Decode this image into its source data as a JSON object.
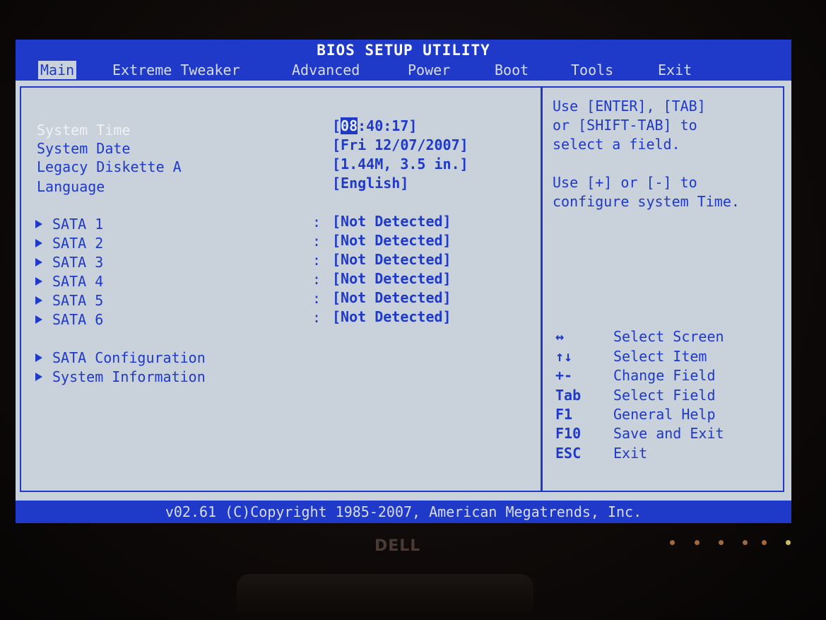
{
  "title": "BIOS SETUP UTILITY",
  "menu": [
    {
      "label": "Main",
      "active": true
    },
    {
      "label": "Extreme Tweaker"
    },
    {
      "label": "Advanced"
    },
    {
      "label": "Power"
    },
    {
      "label": "Boot"
    },
    {
      "label": "Tools"
    },
    {
      "label": "Exit"
    }
  ],
  "settings": [
    {
      "label": "System Time",
      "value_prefix": "[",
      "value_highlight": "08",
      "value_suffix": ":40:17]"
    },
    {
      "label": "System Date",
      "value": "[Fri 12/07/2007]"
    },
    {
      "label": "Legacy Diskette A",
      "value": "[1.44M, 3.5 in.]"
    },
    {
      "label": "Language",
      "value": "[English]"
    }
  ],
  "sata": [
    {
      "label": "SATA 1",
      "sep": ":",
      "value": "[Not Detected]"
    },
    {
      "label": "SATA 2",
      "sep": ":",
      "value": "[Not Detected]"
    },
    {
      "label": "SATA 3",
      "sep": ":",
      "value": "[Not Detected]"
    },
    {
      "label": "SATA 4",
      "sep": ":",
      "value": "[Not Detected]"
    },
    {
      "label": "SATA 5",
      "sep": ":",
      "value": "[Not Detected]"
    },
    {
      "label": "SATA 6",
      "sep": ":",
      "value": "[Not Detected]"
    }
  ],
  "submenus": [
    {
      "label": "SATA Configuration"
    },
    {
      "label": "System Information"
    }
  ],
  "help": {
    "lines1": [
      "Use [ENTER], [TAB]",
      "or [SHIFT-TAB] to",
      "select a field."
    ],
    "lines2": [
      "Use [+] or [-] to",
      "configure system Time."
    ]
  },
  "keys": [
    {
      "key": "↔",
      "desc": "Select Screen"
    },
    {
      "key": "↑↓",
      "desc": "Select Item"
    },
    {
      "key": "+-",
      "desc": "Change Field"
    },
    {
      "key": "Tab",
      "desc": "Select Field"
    },
    {
      "key": "F1",
      "desc": "General Help"
    },
    {
      "key": "F10",
      "desc": "Save and Exit"
    },
    {
      "key": "ESC",
      "desc": "Exit"
    }
  ],
  "footer": "v02.61 (C)Copyright 1985-2007, American Megatrends, Inc.",
  "bezel": {
    "logo": "DELL"
  },
  "colors": {
    "bios_blue": "#1f39c8",
    "panel_gray": "#c9d2da"
  }
}
